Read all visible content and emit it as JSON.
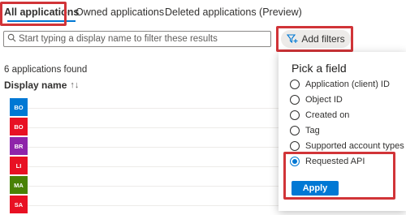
{
  "tabs": [
    {
      "label": "All applications",
      "active": true
    },
    {
      "label": "Owned applications",
      "active": false
    },
    {
      "label": "Deleted applications (Preview)",
      "active": false
    }
  ],
  "search": {
    "placeholder": "Start typing a display name to filter these results",
    "value": "",
    "icon": "search-icon"
  },
  "add_filters": {
    "label": "Add filters",
    "icon": "filter-add-icon"
  },
  "results": {
    "count_text": "6 applications found"
  },
  "table": {
    "column_header": "Display name",
    "sort_icon": "sort-arrows-icon",
    "rows": [
      {
        "badge": "BO",
        "color": "#0078d4"
      },
      {
        "badge": "BO",
        "color": "#e81123"
      },
      {
        "badge": "BR",
        "color": "#8e24aa"
      },
      {
        "badge": "LI",
        "color": "#e81123"
      },
      {
        "badge": "MA",
        "color": "#498205"
      },
      {
        "badge": "SA",
        "color": "#e81123"
      }
    ]
  },
  "flyout": {
    "title": "Pick a field",
    "options": [
      {
        "label": "Application (client) ID",
        "selected": false
      },
      {
        "label": "Object ID",
        "selected": false
      },
      {
        "label": "Created on",
        "selected": false
      },
      {
        "label": "Tag",
        "selected": false
      },
      {
        "label": "Supported account types",
        "selected": false
      },
      {
        "label": "Requested API",
        "selected": true
      }
    ],
    "apply_label": "Apply"
  },
  "colors": {
    "accent": "#0078d4",
    "highlight": "#d13438"
  }
}
